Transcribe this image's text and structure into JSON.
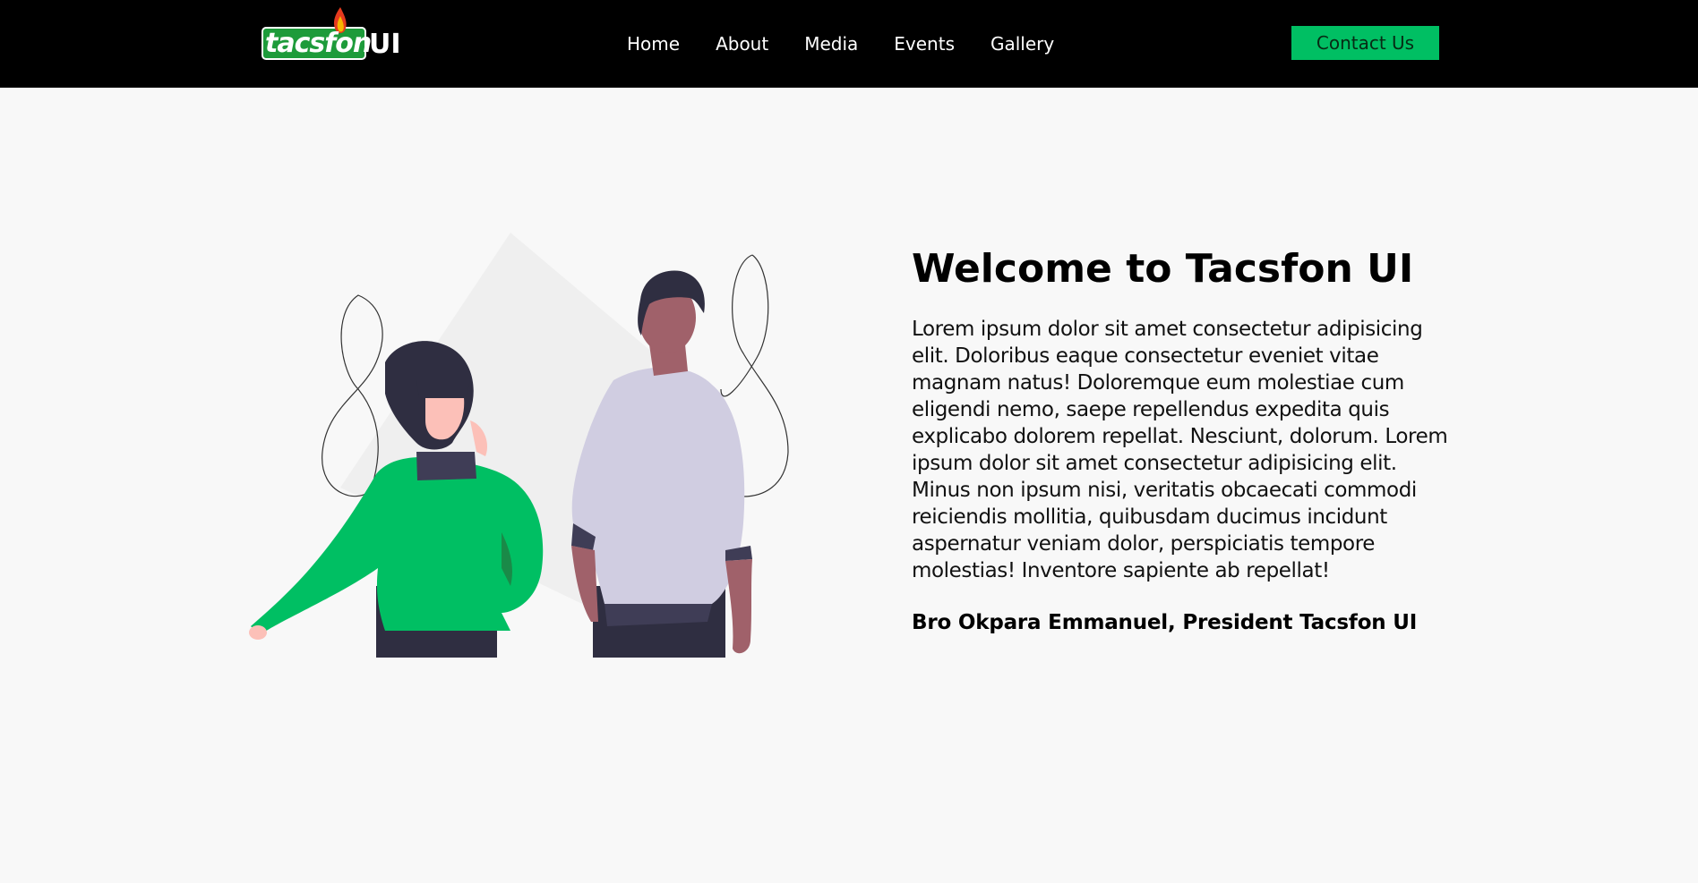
{
  "brand": {
    "wordmark": "tacsfon",
    "suffix": "UI"
  },
  "nav": {
    "items": [
      {
        "label": "Home"
      },
      {
        "label": "About"
      },
      {
        "label": "Media"
      },
      {
        "label": "Events"
      },
      {
        "label": "Gallery"
      }
    ],
    "contact_label": "Contact Us"
  },
  "hero": {
    "title": "Welcome to Tacsfon UI",
    "body": "Lorem ipsum dolor sit amet consectetur adipisicing elit. Doloribus eaque consectetur eveniet vitae magnam natus! Doloremque eum molestiae cum eligendi nemo, saepe repellendus expedita quis explicabo dolorem repellat. Nesciunt, dolorum. Lorem ipsum dolor sit amet consectetur adipisicing elit. Minus non ipsum nisi, veritatis obcaecati commodi reiciendis mollitia, quibusdam ducimus incidunt aspernatur veniam dolor, perspiciatis tempore molestias! Inventore sapiente ab repellat!",
    "signature": "Bro Okpara Emmanuel, President Tacsfon UI"
  },
  "colors": {
    "accent": "#00bf63",
    "navbar": "#000000",
    "background": "#f8f8f8"
  },
  "icons": {
    "logo": "tacsfon-flame-logo",
    "illustration": "two-people-illustration"
  }
}
